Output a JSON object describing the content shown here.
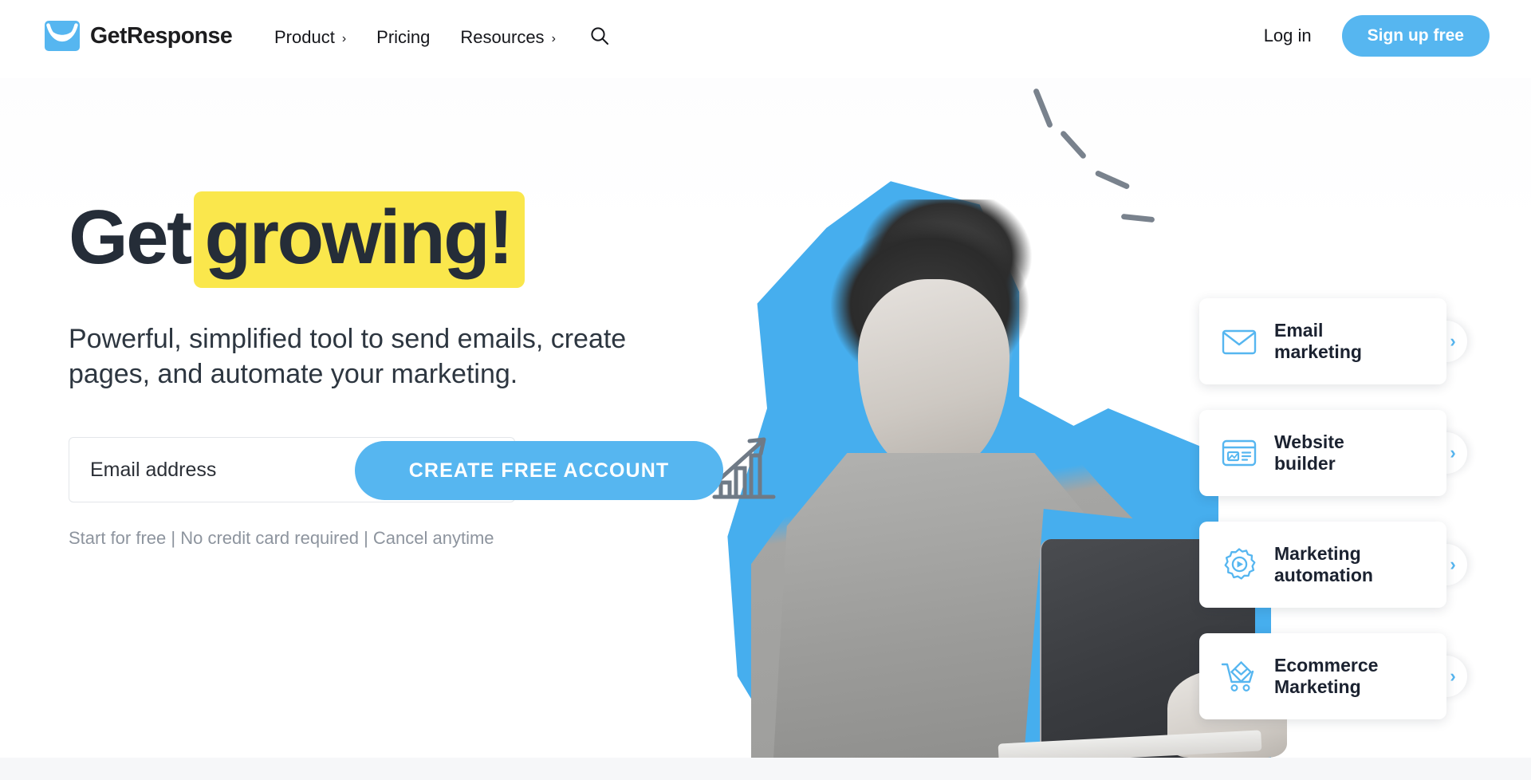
{
  "brand": {
    "name": "GetResponse",
    "logo_icon": "envelope-smile-logo",
    "accent_color": "#56b6f0"
  },
  "header": {
    "nav_items": [
      {
        "label": "Product",
        "caret": "›",
        "has_caret": true
      },
      {
        "label": "Pricing",
        "caret": "",
        "has_caret": false
      },
      {
        "label": "Resources",
        "caret": "›",
        "has_caret": true
      }
    ],
    "search_icon": "search-icon",
    "login_label": "Log in",
    "signup_label": "Sign up free"
  },
  "hero": {
    "headline_plain": "Get",
    "headline_highlight": "growing!",
    "highlight_color": "#fae74c",
    "subheadline": "Powerful, simplified tool to send emails, create pages, and automate your marketing.",
    "email_placeholder": "Email address",
    "email_value": "",
    "cta_label": "CREATE FREE ACCOUNT",
    "disclaimer": "Start for free | No credit card required | Cancel anytime"
  },
  "feature_cards": [
    {
      "label_line1": "Email",
      "label_line2": "marketing",
      "icon": "envelope-icon",
      "chevron": "›"
    },
    {
      "label_line1": "Website",
      "label_line2": "builder",
      "icon": "browser-window-icon",
      "chevron": "›"
    },
    {
      "label_line1": "Marketing",
      "label_line2": "automation",
      "icon": "gear-play-icon",
      "chevron": "›"
    },
    {
      "label_line1": "Ecommerce",
      "label_line2": "Marketing",
      "icon": "shopping-cart-envelope-icon",
      "chevron": "›"
    }
  ],
  "illustration": {
    "subject": "excited-woman-holding-laptop",
    "accent_shape_color": "#46aeee",
    "doodle_growth_chart": "growth-chart-doodle",
    "doodle_dashes": "excitement-dashes"
  }
}
